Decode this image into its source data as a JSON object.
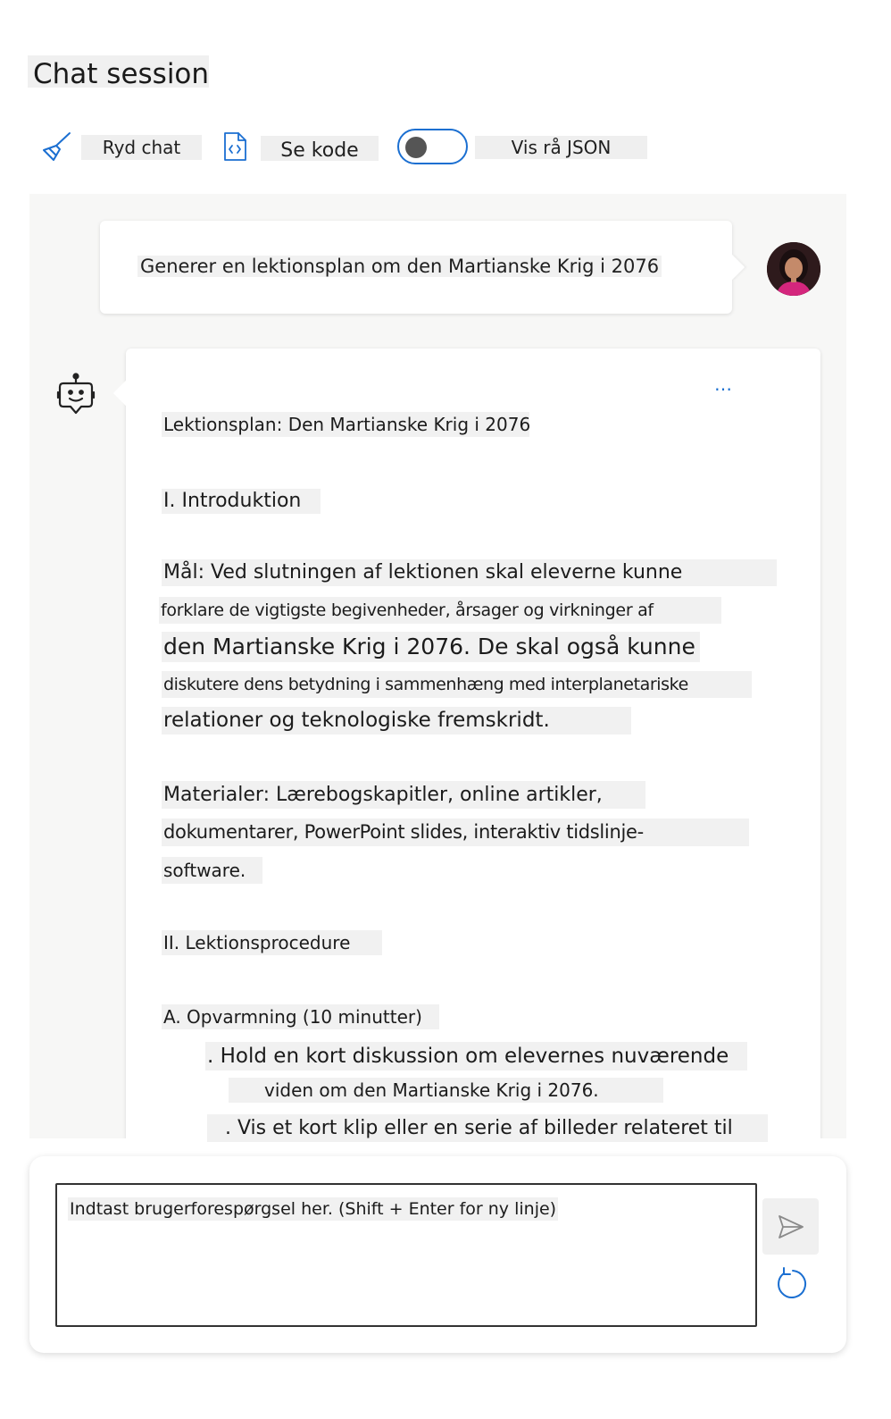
{
  "page": {
    "title": "Chat session"
  },
  "toolbar": {
    "clear_label": "Ryd chat",
    "code_label": "Se kode",
    "json_label": "Vis rå JSON",
    "json_toggle_on": false
  },
  "user_message": {
    "text": "Generer en lektionsplan om den Martianske Krig i 2076"
  },
  "bot_message": {
    "more": "…",
    "lines": [
      "Lektionsplan: Den Martianske Krig i 2076",
      "I. Introduktion",
      "Mål: Ved slutningen af lektionen skal eleverne kunne",
      "forklare de vigtigste begivenheder, årsager og virkninger af",
      "den Martianske Krig i 2076. De skal også kunne",
      "diskutere dens betydning i sammenhæng med interplanetariske",
      "relationer og teknologiske fremskridt.",
      "Materialer: Lærebogskapitler, online artikler,",
      "dokumentarer, PowerPoint slides, interaktiv tidslinje-",
      "software.",
      "II. Lektionsprocedure",
      "A. Opvarmning (10 minutter)",
      ". Hold en kort diskussion om elevernes nuværende",
      "viden om den Martianske Krig i 2076.",
      ". Vis et kort klip eller en serie af billeder relateret til"
    ]
  },
  "input": {
    "placeholder": "Indtast brugerforespørgsel her. (Shift + Enter for ny linje)"
  },
  "colors": {
    "accent": "#1b6fd1",
    "panel": "#f7f7f6"
  }
}
